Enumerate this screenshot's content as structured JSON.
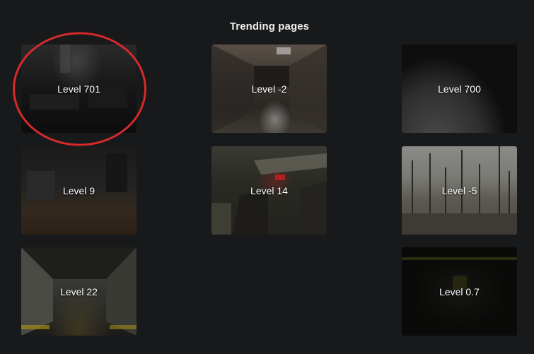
{
  "heading": "Trending pages",
  "cards": [
    {
      "label": "Level 701"
    },
    {
      "label": "Level -2"
    },
    {
      "label": "Level 700"
    },
    {
      "label": "Level 9"
    },
    {
      "label": "Level 14"
    },
    {
      "label": "Level -5"
    },
    {
      "label": "Level 22"
    },
    {
      "label": "Level 0.7"
    }
  ],
  "colors": {
    "background": "#18191b",
    "highlight_circle": "#d42a2a",
    "text": "#ffffff"
  }
}
